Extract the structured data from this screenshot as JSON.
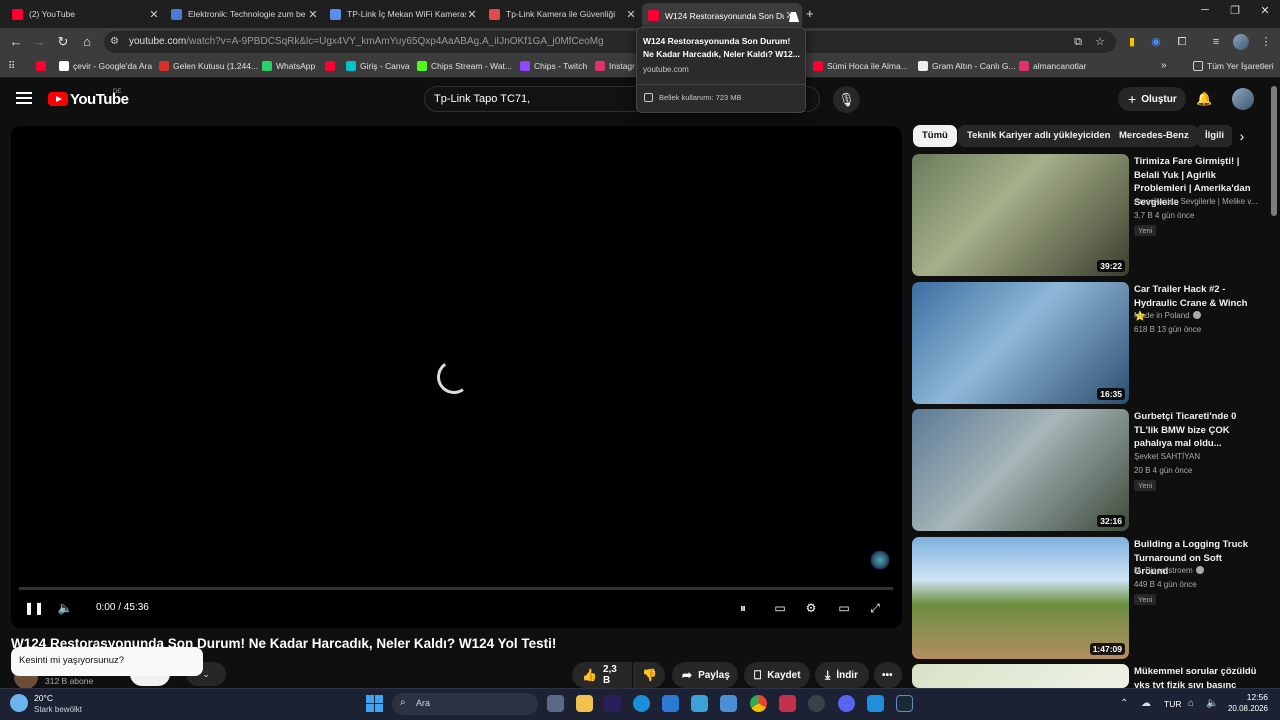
{
  "browser": {
    "tabs": [
      {
        "title": "(2) YouTube",
        "favicon_color": "#ff0033",
        "active": false
      },
      {
        "title": "Elektronik: Technologie zum be",
        "favicon_color": "#4a7bd6",
        "active": false
      },
      {
        "title": "TP-Link İç Mekan WiFi Kameras",
        "favicon_color": "#5b8def",
        "active": false
      },
      {
        "title": "Tp-Link Kamera ile Güvenliği",
        "favicon_color": "#e04b4b",
        "active": false
      },
      {
        "title": "W124 Restorasyonunda Son Du",
        "favicon_color": "#ff0033",
        "active": true
      }
    ],
    "new_tab_label": "+",
    "url_host": "youtube.com",
    "url_path": "/watch?v=A-9PBDCSqRk&lc=Ugx4VY_kmAmYuy65Qxp4AaABAg.A_iIJnOKf1GA_j0MfCeoMg",
    "bookmarks": [
      {
        "label": "",
        "color": "#ff0033"
      },
      {
        "label": "çevir - Google'da Ara",
        "color": "#ffffff"
      },
      {
        "label": "Gelen Kutusu (1.244...",
        "color": "#d93025"
      },
      {
        "label": "WhatsApp",
        "color": "#25d366"
      },
      {
        "label": "",
        "color": "#ff0033"
      },
      {
        "label": "Giriş - Canva",
        "color": "#00c4cc"
      },
      {
        "label": "Chips Stream - Wat...",
        "color": "#53fc18"
      },
      {
        "label": "Chips - Twitch",
        "color": "#9146ff"
      },
      {
        "label": "Instagr",
        "color": "#e1306c"
      },
      {
        "label": "Sümi Hoca ile Alma...",
        "color": "#ff0033"
      },
      {
        "label": "Gram Altın - Canlı G...",
        "color": "#eeeeee"
      },
      {
        "label": "almancanotlar",
        "color": "#e1306c"
      }
    ],
    "all_bookmarks_label": "Tüm Yer İşaretleri",
    "hover_card": {
      "title": "W124 Restorasyonunda Son Durum! Ne Kadar Harcadık, Neler Kaldı? W12...",
      "domain": "youtube.com",
      "memory": "Bellek kullanımı: 723 MB"
    }
  },
  "youtube": {
    "logo_text": "YouTube",
    "region": "DE",
    "search_query": "Tp-Link Tapo TC71,",
    "create_label": "Oluştur",
    "player": {
      "time": "0:00 / 45:36",
      "progress_fraction": 0.0
    },
    "video_title": "W124 Restorasyonunda Son Durum! Ne Kadar Harcadık, Neler Kaldı? W124 Yol Testi!",
    "subscribers": "312 B abone",
    "actions": {
      "likes": "2,3 B",
      "share": "Paylaş",
      "save": "Kaydet",
      "download": "İndir"
    },
    "question_popup": "Kesinti mi yaşıyorsunuz?",
    "chips": [
      "Tümü",
      "Teknik Kariyer adlı yükleyiciden",
      "Mercedes-Benz",
      "İlgili"
    ],
    "recommendations": [
      {
        "title": "Tirimiza Fare Girmişti! | Belali Yuk | Agirlik Problemleri | Amerika'dan Sevgilerle",
        "channel": "Amerika'dan Sevgilerle | Melike v...",
        "meta": "3,7 B   4 gün önce",
        "badge": "Yeni",
        "duration": "39:22",
        "verified": false,
        "thumb_bg": "linear-gradient(135deg,#6a7a5a,#a6b08a 40%,#3a3f2e)"
      },
      {
        "title": "Car Trailer Hack #2 - Hydraulic Crane & Winch ⭐",
        "channel": "Made in Poland",
        "meta": "618 B   13 gün önce",
        "badge": "",
        "duration": "16:35",
        "verified": true,
        "thumb_bg": "linear-gradient(135deg,#3a6fa0,#8fb7d8 45%,#2c4e70)"
      },
      {
        "title": "Gurbetçi Ticareti'nde 0 TL'lik BMW bize ÇOK pahalıya mal oldu...",
        "channel": "Şevket SAHTİYAN",
        "meta": "20 B   4 gün önce",
        "badge": "Yeni",
        "duration": "32:16",
        "verified": false,
        "thumb_bg": "linear-gradient(135deg,#5b7a95,#a7b6b8 45%,#3c4a3a)"
      },
      {
        "title": "Building a Logging Truck Turnaround on Soft Ground",
        "channel": "M. Bjoernstroem",
        "meta": "449 B   4 gün önce",
        "badge": "Yeni",
        "duration": "1:47:09",
        "verified": true,
        "thumb_bg": "linear-gradient(180deg,#7fb0df 0%,#cfe4f5 35%,#6c8e3f 55%,#b48d62 100%)"
      },
      {
        "title": "Mükemmel sorular çözüldü yks tyt fizik sıvı basınç",
        "channel": "",
        "meta": "",
        "badge": "",
        "duration": "",
        "verified": false,
        "thumb_bg": "linear-gradient(135deg,#d8e2c8,#eef2e6)"
      }
    ]
  },
  "taskbar": {
    "temperature": "20°C",
    "weather": "Stark bewölkt",
    "search_placeholder": "Ara",
    "language": "TUR",
    "time": "12:56",
    "date": "20.08.2026"
  }
}
